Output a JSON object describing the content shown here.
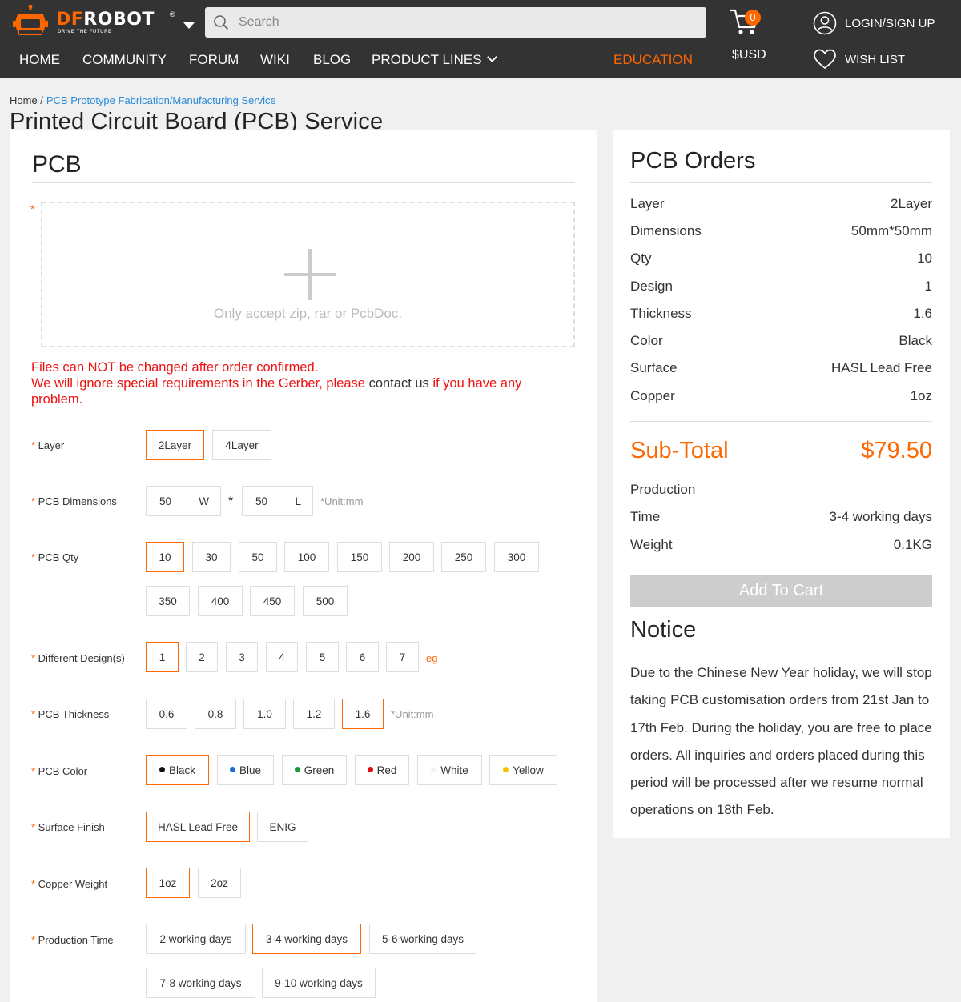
{
  "header": {
    "logo_brand_a": "DF",
    "logo_brand_b": "ROBOT",
    "logo_reg": "®",
    "logo_tagline": "DRIVE THE FUTURE",
    "search_placeholder": "Search",
    "cart_count": "0",
    "currency": "$USD",
    "login_label": "LOGIN/SIGN UP",
    "wishlist_label": "WISH LIST",
    "accent_color": "#fe6600"
  },
  "nav": {
    "home": "HOME",
    "community": "COMMUNITY",
    "forum": "FORUM",
    "wiki": "WIKI",
    "blog": "BLOG",
    "product_lines": "PRODUCT LINES",
    "education": "EDUCATION"
  },
  "breadcrumb": {
    "home": "Home /",
    "current": "PCB Prototype Fabrication/Manufacturing Service"
  },
  "page_title": "Printed Circuit Board (PCB) Service",
  "form": {
    "title": "PCB",
    "upload_hint": "Only accept zip, rar or PcbDoc.",
    "warning_line1": "Files can NOT be changed after order confirmed.",
    "warning_line2a": "We will ignore special requirements in the Gerber, please ",
    "warning_contact": "contact us",
    "warning_line2b": " if you have any problem.",
    "layer": {
      "label": "Layer",
      "options": [
        "2Layer",
        "4Layer"
      ]
    },
    "dimensions": {
      "label": "PCB Dimensions",
      "width": "50",
      "width_unit": "W",
      "length": "50",
      "length_unit": "L",
      "separator": "*",
      "unit": "*Unit:mm"
    },
    "qty": {
      "label": "PCB Qty",
      "options": [
        "10",
        "30",
        "50",
        "100",
        "150",
        "200",
        "250",
        "300",
        "350",
        "400",
        "450",
        "500"
      ]
    },
    "designs": {
      "label": "Different Design(s)",
      "options": [
        "1",
        "2",
        "3",
        "4",
        "5",
        "6",
        "7"
      ],
      "eg": "eg"
    },
    "thickness": {
      "label": "PCB Thickness",
      "options": [
        "0.6",
        "0.8",
        "1.0",
        "1.2",
        "1.6"
      ],
      "unit": "*Unit:mm"
    },
    "color": {
      "label": "PCB Color",
      "options": [
        "Black",
        "Blue",
        "Green",
        "Red",
        "White",
        "Yellow"
      ],
      "dots": [
        "#111111",
        "#1a6fd0",
        "#1a9a3a",
        "#e01010",
        "#f4f4f4",
        "#f2c400"
      ]
    },
    "surface": {
      "label": "Surface Finish",
      "options": [
        "HASL Lead Free",
        "ENIG"
      ]
    },
    "copper": {
      "label": "Copper Weight",
      "options": [
        "1oz",
        "2oz"
      ]
    },
    "production": {
      "label": "Production Time",
      "options": [
        "2 working days",
        "3-4 working days",
        "5-6 working days",
        "7-8 working days",
        "9-10 working days"
      ]
    }
  },
  "orders": {
    "title": "PCB Orders",
    "rows": [
      {
        "k": "Layer",
        "v": "2Layer"
      },
      {
        "k": "Dimensions",
        "v": "50mm*50mm"
      },
      {
        "k": "Qty",
        "v": "10"
      },
      {
        "k": "Design",
        "v": "1"
      },
      {
        "k": "Thickness",
        "v": "1.6"
      },
      {
        "k": "Color",
        "v": "Black"
      },
      {
        "k": "Surface",
        "v": "HASL Lead Free"
      },
      {
        "k": "Copper",
        "v": "1oz"
      }
    ],
    "subtotal_label": "Sub-Total",
    "subtotal_value": "$79.50",
    "production_label": "Production",
    "time_label": "Time",
    "time_value": "3-4 working days",
    "weight_label": "Weight",
    "weight_value": "0.1KG",
    "add_to_cart": "Add To Cart",
    "notice_title": "Notice",
    "notice_text": "Due to the Chinese New Year holiday, we will stop taking PCB customisation orders from 21st Jan to 17th Feb. During the holiday, you are free to place orders. All inquiries and orders placed during this period will be processed after we resume normal operations on 18th Feb."
  }
}
